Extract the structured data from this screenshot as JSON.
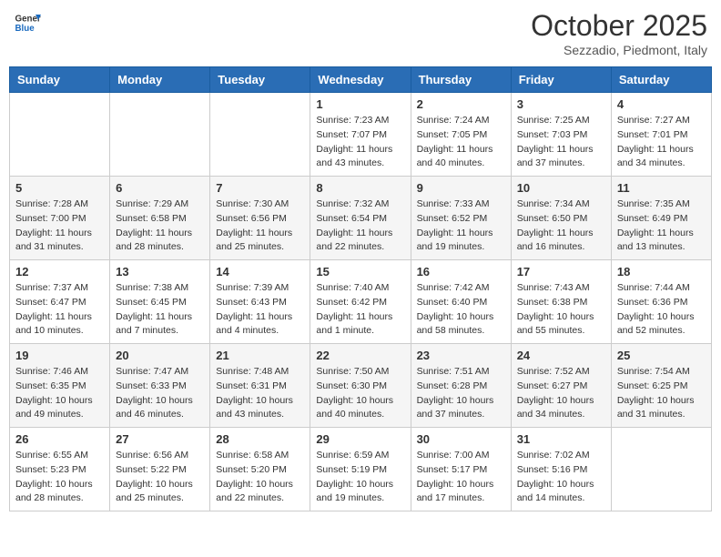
{
  "header": {
    "logo_general": "General",
    "logo_blue": "Blue",
    "month_title": "October 2025",
    "location": "Sezzadio, Piedmont, Italy"
  },
  "days_of_week": [
    "Sunday",
    "Monday",
    "Tuesday",
    "Wednesday",
    "Thursday",
    "Friday",
    "Saturday"
  ],
  "weeks": [
    [
      {
        "day": "",
        "info": ""
      },
      {
        "day": "",
        "info": ""
      },
      {
        "day": "",
        "info": ""
      },
      {
        "day": "1",
        "info": "Sunrise: 7:23 AM\nSunset: 7:07 PM\nDaylight: 11 hours and 43 minutes."
      },
      {
        "day": "2",
        "info": "Sunrise: 7:24 AM\nSunset: 7:05 PM\nDaylight: 11 hours and 40 minutes."
      },
      {
        "day": "3",
        "info": "Sunrise: 7:25 AM\nSunset: 7:03 PM\nDaylight: 11 hours and 37 minutes."
      },
      {
        "day": "4",
        "info": "Sunrise: 7:27 AM\nSunset: 7:01 PM\nDaylight: 11 hours and 34 minutes."
      }
    ],
    [
      {
        "day": "5",
        "info": "Sunrise: 7:28 AM\nSunset: 7:00 PM\nDaylight: 11 hours and 31 minutes."
      },
      {
        "day": "6",
        "info": "Sunrise: 7:29 AM\nSunset: 6:58 PM\nDaylight: 11 hours and 28 minutes."
      },
      {
        "day": "7",
        "info": "Sunrise: 7:30 AM\nSunset: 6:56 PM\nDaylight: 11 hours and 25 minutes."
      },
      {
        "day": "8",
        "info": "Sunrise: 7:32 AM\nSunset: 6:54 PM\nDaylight: 11 hours and 22 minutes."
      },
      {
        "day": "9",
        "info": "Sunrise: 7:33 AM\nSunset: 6:52 PM\nDaylight: 11 hours and 19 minutes."
      },
      {
        "day": "10",
        "info": "Sunrise: 7:34 AM\nSunset: 6:50 PM\nDaylight: 11 hours and 16 minutes."
      },
      {
        "day": "11",
        "info": "Sunrise: 7:35 AM\nSunset: 6:49 PM\nDaylight: 11 hours and 13 minutes."
      }
    ],
    [
      {
        "day": "12",
        "info": "Sunrise: 7:37 AM\nSunset: 6:47 PM\nDaylight: 11 hours and 10 minutes."
      },
      {
        "day": "13",
        "info": "Sunrise: 7:38 AM\nSunset: 6:45 PM\nDaylight: 11 hours and 7 minutes."
      },
      {
        "day": "14",
        "info": "Sunrise: 7:39 AM\nSunset: 6:43 PM\nDaylight: 11 hours and 4 minutes."
      },
      {
        "day": "15",
        "info": "Sunrise: 7:40 AM\nSunset: 6:42 PM\nDaylight: 11 hours and 1 minute."
      },
      {
        "day": "16",
        "info": "Sunrise: 7:42 AM\nSunset: 6:40 PM\nDaylight: 10 hours and 58 minutes."
      },
      {
        "day": "17",
        "info": "Sunrise: 7:43 AM\nSunset: 6:38 PM\nDaylight: 10 hours and 55 minutes."
      },
      {
        "day": "18",
        "info": "Sunrise: 7:44 AM\nSunset: 6:36 PM\nDaylight: 10 hours and 52 minutes."
      }
    ],
    [
      {
        "day": "19",
        "info": "Sunrise: 7:46 AM\nSunset: 6:35 PM\nDaylight: 10 hours and 49 minutes."
      },
      {
        "day": "20",
        "info": "Sunrise: 7:47 AM\nSunset: 6:33 PM\nDaylight: 10 hours and 46 minutes."
      },
      {
        "day": "21",
        "info": "Sunrise: 7:48 AM\nSunset: 6:31 PM\nDaylight: 10 hours and 43 minutes."
      },
      {
        "day": "22",
        "info": "Sunrise: 7:50 AM\nSunset: 6:30 PM\nDaylight: 10 hours and 40 minutes."
      },
      {
        "day": "23",
        "info": "Sunrise: 7:51 AM\nSunset: 6:28 PM\nDaylight: 10 hours and 37 minutes."
      },
      {
        "day": "24",
        "info": "Sunrise: 7:52 AM\nSunset: 6:27 PM\nDaylight: 10 hours and 34 minutes."
      },
      {
        "day": "25",
        "info": "Sunrise: 7:54 AM\nSunset: 6:25 PM\nDaylight: 10 hours and 31 minutes."
      }
    ],
    [
      {
        "day": "26",
        "info": "Sunrise: 6:55 AM\nSunset: 5:23 PM\nDaylight: 10 hours and 28 minutes."
      },
      {
        "day": "27",
        "info": "Sunrise: 6:56 AM\nSunset: 5:22 PM\nDaylight: 10 hours and 25 minutes."
      },
      {
        "day": "28",
        "info": "Sunrise: 6:58 AM\nSunset: 5:20 PM\nDaylight: 10 hours and 22 minutes."
      },
      {
        "day": "29",
        "info": "Sunrise: 6:59 AM\nSunset: 5:19 PM\nDaylight: 10 hours and 19 minutes."
      },
      {
        "day": "30",
        "info": "Sunrise: 7:00 AM\nSunset: 5:17 PM\nDaylight: 10 hours and 17 minutes."
      },
      {
        "day": "31",
        "info": "Sunrise: 7:02 AM\nSunset: 5:16 PM\nDaylight: 10 hours and 14 minutes."
      },
      {
        "day": "",
        "info": ""
      }
    ]
  ]
}
